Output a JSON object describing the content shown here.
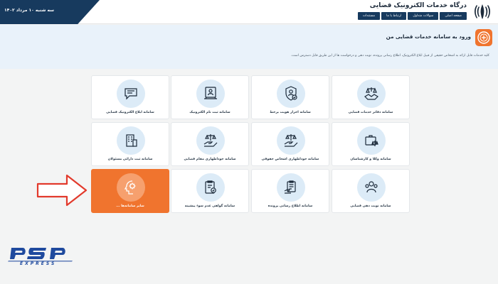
{
  "header": {
    "date": "سه شنبه ۱۰ مرداد ۱۴۰۲",
    "site_title": "درگاه خدمات الکترونیک قضایی",
    "emblem_icon": "iran-emblem-icon",
    "nav": [
      "صفحه اصلی",
      "سوالات متداول",
      "ارتباط با ما",
      "مستندات"
    ]
  },
  "intro": {
    "icon": "judiciary-seal-icon",
    "title": "ورود به سامانه خدمات قضایی من",
    "description": "کلیه خدمات قابل ارائه به اشخاص حقیقی از قبیل ابلاغ الکترونیک، اطلاع رسانی پرونده، نوبت دهی و درخواست ها از این طریق قابل دسترس است."
  },
  "cards": [
    {
      "label": "سامانه دفاتر خدمات قضایی",
      "icon": "handshake-scales-icon"
    },
    {
      "label": "سامانه احراز هویت برخط",
      "icon": "shield-user-check-icon"
    },
    {
      "label": "سامانه ثبت نام الکترونیک",
      "icon": "id-card-monitor-icon"
    },
    {
      "label": "سامانه ابلاغ الکترونیک قضایی",
      "icon": "chat-document-icon"
    },
    {
      "label": "سامانه وکلا و کارشناسان",
      "icon": "briefcase-scales-icon"
    },
    {
      "label": "سامانه خوداظهاری اشخاص حقوقی",
      "icon": "hand-scales-icon"
    },
    {
      "label": "سامانه خوداظهاری مقام قضایی",
      "icon": "hand-scales-icon"
    },
    {
      "label": "سامانه ثبت دارائی مسئولان",
      "icon": "building-document-icon"
    },
    {
      "label": "سامانه نوبت دهی قضایی",
      "icon": "people-group-icon"
    },
    {
      "label": "سامانه اطلاع رسانی پرونده",
      "icon": "clipboard-hand-icon"
    },
    {
      "label": "سامانه گواهی عدم سوء پیشینه",
      "icon": "clipboard-badge-icon"
    },
    {
      "label": "سایر سامانه‌ها ...",
      "icon": "gear-head-icon",
      "active": true
    }
  ],
  "logo": {
    "brand": "PSP",
    "tagline": "EXPRESS"
  },
  "colors": {
    "navy": "#173a5e",
    "accent": "#f0742e",
    "icon_bg": "#dcebf7"
  }
}
